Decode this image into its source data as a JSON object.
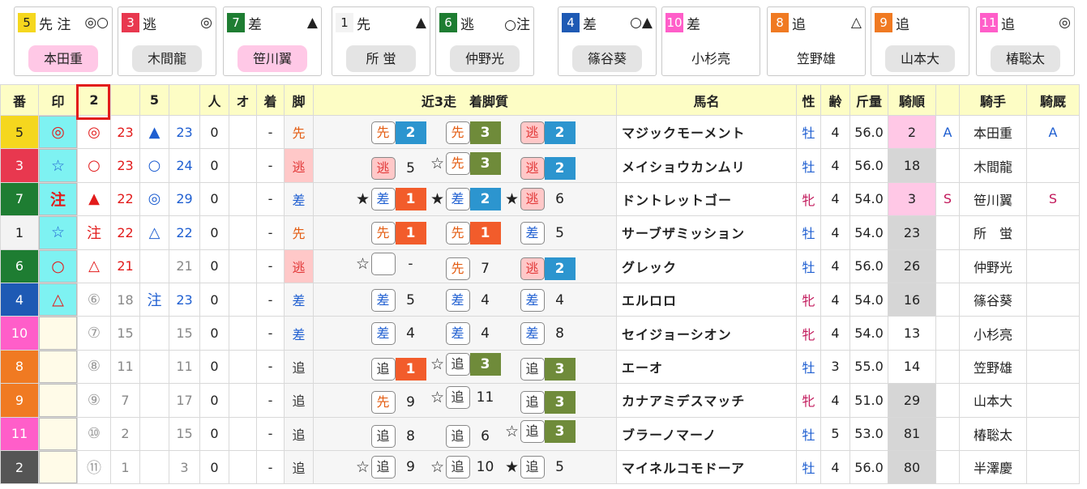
{
  "colors": {
    "frame_1": "#ffffff",
    "frame_2": "#000000",
    "frame_3": "#e8384f",
    "frame_4": "#1e5ab4",
    "frame_5": "#f5d71e",
    "frame_6": "#1e7d32",
    "frame_7": "#f07a22",
    "frame_8": "#ff5ec9",
    "mark_cyan": "#7ef2f2",
    "mark_light": "#fffbe8",
    "hot_pink": "#ffc8e6",
    "grey_rank": "#d6d6d6",
    "place_1": "#f25c2b",
    "place_2": "#2c95cf",
    "place_3": "#6f8b3a",
    "style_nige": "#ffc8c8"
  },
  "cards": [
    {
      "num": "5",
      "style": "先 注",
      "mark": "◎○",
      "jockey": "本田重",
      "pink": true,
      "bg": "#f5d71e",
      "fg": "#222"
    },
    {
      "num": "3",
      "style": "逃",
      "mark": "◎",
      "jockey": "木間龍",
      "pink": false,
      "bg": "#e8384f",
      "fg": "#fff"
    },
    {
      "num": "7",
      "style": "差",
      "mark": "▲",
      "jockey": "笹川翼",
      "pink": true,
      "bg": "#1e7d32",
      "fg": "#fff"
    },
    {
      "num": "1",
      "style": "先",
      "mark": "▲",
      "jockey": "所 蛍",
      "pink": false,
      "bg": "#f3f3f3",
      "fg": "#222"
    },
    {
      "num": "6",
      "style": "逃",
      "mark": "○注",
      "jockey": "仲野光",
      "pink": false,
      "bg": "#1e7d32",
      "fg": "#fff"
    },
    {
      "num": "4",
      "style": "差",
      "mark": "○▲",
      "jockey": "篠谷葵",
      "pink": false,
      "bg": "#1e5ab4",
      "fg": "#fff"
    },
    {
      "num": "10",
      "style": "差",
      "mark": "",
      "jockey": "小杉亮",
      "pink": false,
      "none": true,
      "bg": "#ff5ec9",
      "fg": "#fff"
    },
    {
      "num": "8",
      "style": "追",
      "mark": "△",
      "jockey": "笠野雄",
      "pink": false,
      "none": true,
      "bg": "#f07a22",
      "fg": "#fff"
    },
    {
      "num": "9",
      "style": "追",
      "mark": "",
      "jockey": "山本大",
      "pink": false,
      "bg": "#f07a22",
      "fg": "#fff"
    },
    {
      "num": "11",
      "style": "追",
      "mark": "◎",
      "jockey": "椿聡太",
      "pink": false,
      "bg": "#ff5ec9",
      "fg": "#fff"
    }
  ],
  "headers": [
    "番",
    "印",
    "2",
    "",
    "5",
    "",
    "人",
    "オ",
    "着",
    "脚",
    "近3走　着脚質",
    "馬名",
    "性",
    "齢",
    "斤量",
    "騎順",
    "",
    "騎手",
    "騎厩"
  ],
  "rows": [
    {
      "num": "5",
      "mark": "◎",
      "m2": "◎",
      "v2": "23",
      "m5": "▲",
      "v5": "23",
      "pop": "0",
      "odds": "",
      "fin": "-",
      "style": "先",
      "recent": [
        {
          "star": "",
          "s": "先",
          "p": "2"
        },
        {
          "star": "",
          "s": "先",
          "p": "3"
        },
        {
          "star": "",
          "s": "逃",
          "p": "2"
        }
      ],
      "name": "マジックモーメント",
      "sex": "牡",
      "age": "4",
      "wt": "56.0",
      "jr": "2",
      "jm": "A",
      "jockey": "本田重",
      "jst": "A",
      "cls": "#f5d71e",
      "fc": "#222",
      "mc": "#7ef2f2"
    },
    {
      "num": "3",
      "mark": "☆",
      "m2": "○",
      "v2": "23",
      "m5": "○",
      "v5": "24",
      "pop": "0",
      "odds": "",
      "fin": "-",
      "style": "逃",
      "recent": [
        {
          "star": "",
          "s": "逃",
          "p": "5"
        },
        {
          "star": "☆",
          "s": "先",
          "p": "3"
        },
        {
          "star": "",
          "s": "逃",
          "p": "2"
        }
      ],
      "name": "メイショウカンムリ",
      "sex": "牡",
      "age": "4",
      "wt": "56.0",
      "jr": "18",
      "jm": "",
      "jockey": "木間龍",
      "jst": "",
      "cls": "#e8384f",
      "fc": "#fff",
      "mc": "#7ef2f2"
    },
    {
      "num": "7",
      "mark": "注",
      "m2": "▲",
      "v2": "22",
      "m5": "◎",
      "v5": "29",
      "pop": "0",
      "odds": "",
      "fin": "-",
      "style": "差",
      "recent": [
        {
          "star": "★",
          "s": "差",
          "p": "1"
        },
        {
          "star": "★",
          "s": "差",
          "p": "2"
        },
        {
          "star": "★",
          "s": "逃",
          "p": "6"
        }
      ],
      "name": "ドントレットゴー",
      "sex": "牝",
      "age": "4",
      "wt": "54.0",
      "jr": "3",
      "jm": "S",
      "jockey": "笹川翼",
      "jst": "S",
      "cls": "#1e7d32",
      "fc": "#fff",
      "mc": "#7ef2f2"
    },
    {
      "num": "1",
      "mark": "☆",
      "m2": "注",
      "v2": "22",
      "m5": "△",
      "v5": "22",
      "pop": "0",
      "odds": "",
      "fin": "-",
      "style": "先",
      "recent": [
        {
          "star": "",
          "s": "先",
          "p": "1"
        },
        {
          "star": "",
          "s": "先",
          "p": "1"
        },
        {
          "star": "",
          "s": "差",
          "p": "5"
        }
      ],
      "name": "サーブザミッション",
      "sex": "牡",
      "age": "4",
      "wt": "54.0",
      "jr": "23",
      "jm": "",
      "jockey": "所　蛍",
      "jst": "",
      "cls": "#f3f3f3",
      "fc": "#222",
      "mc": "#7ef2f2"
    },
    {
      "num": "6",
      "mark": "○",
      "m2": "△",
      "v2": "21",
      "m5": "",
      "v5": "21",
      "pop": "0",
      "odds": "",
      "fin": "-",
      "style": "逃",
      "recent": [
        {
          "star": "☆",
          "s": "",
          "p": "-"
        },
        {
          "star": "",
          "s": "先",
          "p": "7"
        },
        {
          "star": "",
          "s": "逃",
          "p": "2"
        }
      ],
      "name": "グレック",
      "sex": "牡",
      "age": "4",
      "wt": "56.0",
      "jr": "26",
      "jm": "",
      "jockey": "仲野光",
      "jst": "",
      "cls": "#1e7d32",
      "fc": "#fff",
      "mc": "#7ef2f2"
    },
    {
      "num": "4",
      "mark": "△",
      "m2": "⑥",
      "v2": "18",
      "m5": "注",
      "v5": "23",
      "pop": "0",
      "odds": "",
      "fin": "-",
      "style": "差",
      "recent": [
        {
          "star": "",
          "s": "差",
          "p": "5"
        },
        {
          "star": "",
          "s": "差",
          "p": "4"
        },
        {
          "star": "",
          "s": "差",
          "p": "4"
        }
      ],
      "name": "エルロロ",
      "sex": "牝",
      "age": "4",
      "wt": "54.0",
      "jr": "16",
      "jm": "",
      "jockey": "篠谷葵",
      "jst": "",
      "cls": "#1e5ab4",
      "fc": "#fff",
      "mc": "#7ef2f2"
    },
    {
      "num": "10",
      "mark": "",
      "m2": "⑦",
      "v2": "15",
      "m5": "",
      "v5": "15",
      "pop": "0",
      "odds": "",
      "fin": "-",
      "style": "差",
      "recent": [
        {
          "star": "",
          "s": "差",
          "p": "4"
        },
        {
          "star": "",
          "s": "差",
          "p": "4"
        },
        {
          "star": "",
          "s": "差",
          "p": "8"
        }
      ],
      "name": "セイジョーシオン",
      "sex": "牝",
      "age": "4",
      "wt": "54.0",
      "jr": "13",
      "jm": "",
      "jockey": "小杉亮",
      "jst": "",
      "cls": "#ff5ec9",
      "fc": "#fff",
      "mc": "#fffbe8"
    },
    {
      "num": "8",
      "mark": "",
      "m2": "⑧",
      "v2": "11",
      "m5": "",
      "v5": "11",
      "pop": "0",
      "odds": "",
      "fin": "-",
      "style": "追",
      "recent": [
        {
          "star": "",
          "s": "追",
          "p": "1"
        },
        {
          "star": "☆",
          "s": "追",
          "p": "3"
        },
        {
          "star": "",
          "s": "追",
          "p": "3"
        }
      ],
      "name": "エーオ",
      "sex": "牡",
      "age": "3",
      "wt": "55.0",
      "jr": "14",
      "jm": "",
      "jockey": "笠野雄",
      "jst": "",
      "cls": "#f07a22",
      "fc": "#fff",
      "mc": "#fffbe8"
    },
    {
      "num": "9",
      "mark": "",
      "m2": "⑨",
      "v2": "7",
      "m5": "",
      "v5": "17",
      "pop": "0",
      "odds": "",
      "fin": "-",
      "style": "追",
      "recent": [
        {
          "star": "",
          "s": "先",
          "p": "9"
        },
        {
          "star": "☆",
          "s": "追",
          "p": "11"
        },
        {
          "star": "",
          "s": "追",
          "p": "3"
        }
      ],
      "name": "カナアミデスマッチ",
      "sex": "牝",
      "age": "4",
      "wt": "51.0",
      "jr": "29",
      "jm": "",
      "jockey": "山本大",
      "jst": "",
      "cls": "#f07a22",
      "fc": "#fff",
      "mc": "#fffbe8"
    },
    {
      "num": "11",
      "mark": "",
      "m2": "⑩",
      "v2": "2",
      "m5": "",
      "v5": "15",
      "pop": "0",
      "odds": "",
      "fin": "-",
      "style": "追",
      "recent": [
        {
          "star": "",
          "s": "追",
          "p": "8"
        },
        {
          "star": "",
          "s": "追",
          "p": "6"
        },
        {
          "star": "☆",
          "s": "追",
          "p": "3"
        }
      ],
      "name": "ブラーノマーノ",
      "sex": "牡",
      "age": "5",
      "wt": "53.0",
      "jr": "81",
      "jm": "",
      "jockey": "椿聡太",
      "jst": "",
      "cls": "#ff5ec9",
      "fc": "#fff",
      "mc": "#fffbe8"
    },
    {
      "num": "2",
      "mark": "",
      "m2": "⑪",
      "v2": "1",
      "m5": "",
      "v5": "3",
      "pop": "0",
      "odds": "",
      "fin": "-",
      "style": "追",
      "recent": [
        {
          "star": "☆",
          "s": "追",
          "p": "9"
        },
        {
          "star": "☆",
          "s": "追",
          "p": "10"
        },
        {
          "star": "★",
          "s": "追",
          "p": "5"
        }
      ],
      "name": "マイネルコモドーア",
      "sex": "牡",
      "age": "4",
      "wt": "56.0",
      "jr": "80",
      "jm": "",
      "jockey": "半澤慶",
      "jst": "",
      "cls": "#555555",
      "fc": "#fff",
      "mc": "#fffbe8"
    }
  ]
}
